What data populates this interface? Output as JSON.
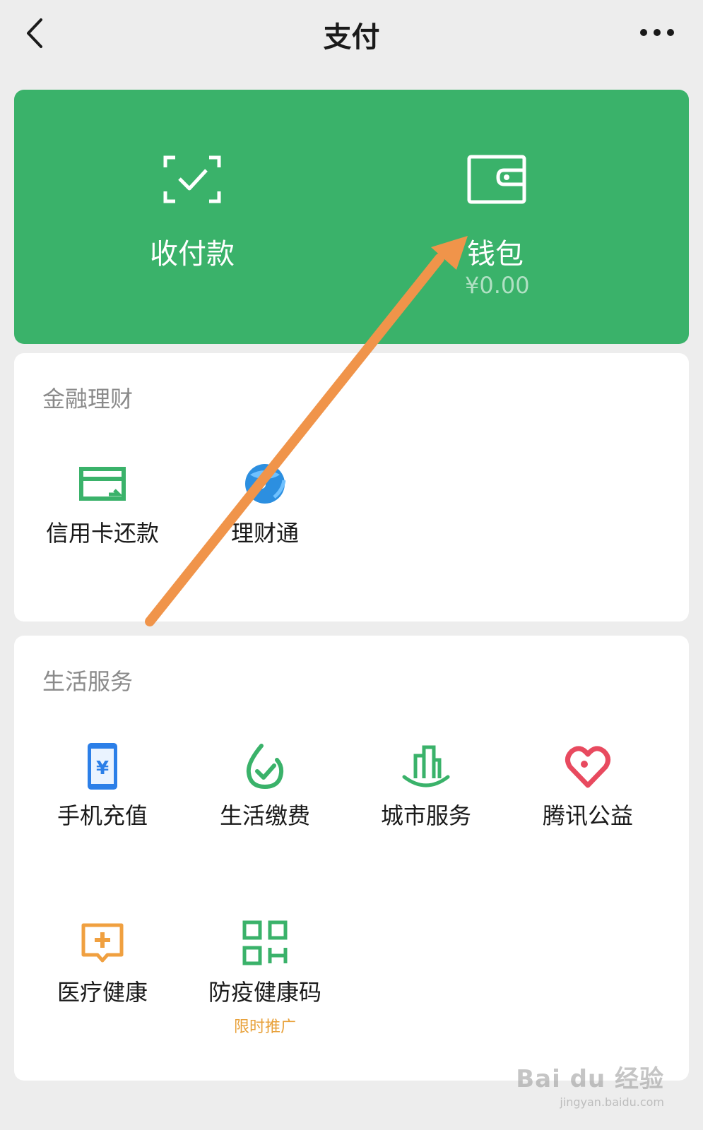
{
  "nav": {
    "title": "支付"
  },
  "top_card": {
    "receive_pay_label": "收付款",
    "wallet_label": "钱包",
    "wallet_amount": "¥0.00",
    "bg_color": "#3ab26a"
  },
  "finance": {
    "title": "金融理财",
    "items": [
      {
        "label": "信用卡还款",
        "icon": "credit-card-icon"
      },
      {
        "label": "理财通",
        "icon": "wealth-icon"
      }
    ]
  },
  "life": {
    "title": "生活服务",
    "items": [
      {
        "label": "手机充值",
        "icon": "phone-recharge-icon"
      },
      {
        "label": "生活缴费",
        "icon": "utility-payment-icon"
      },
      {
        "label": "城市服务",
        "icon": "city-service-icon"
      },
      {
        "label": "腾讯公益",
        "icon": "charity-icon"
      },
      {
        "label": "医疗健康",
        "icon": "medical-icon"
      },
      {
        "label": "防疫健康码",
        "icon": "health-code-icon",
        "sub": "限时推广"
      }
    ]
  },
  "watermark": {
    "logo": "Bai du 经验",
    "url": "jingyan.baidu.com"
  },
  "colors": {
    "accent_green": "#3ab26a",
    "arrow": "#f0944a",
    "promo": "#e8a13a"
  }
}
